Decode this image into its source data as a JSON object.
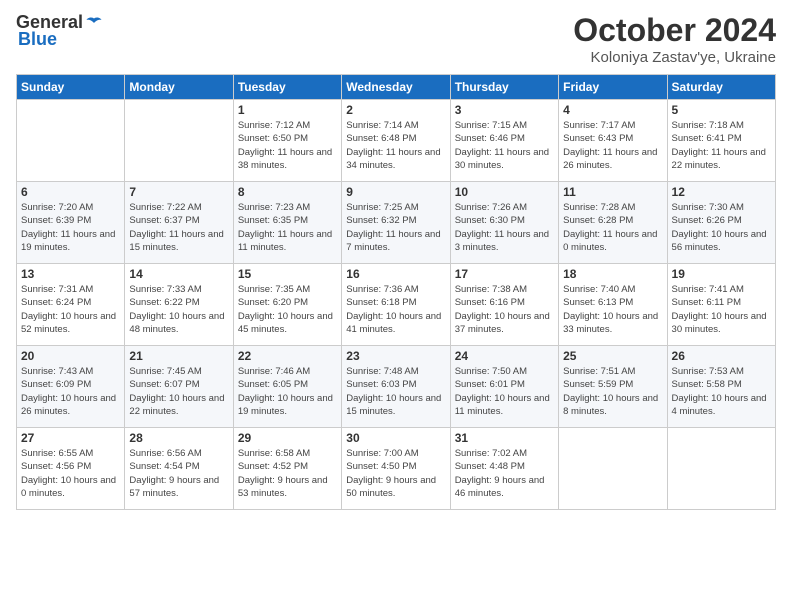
{
  "logo": {
    "general": "General",
    "blue": "Blue"
  },
  "title": "October 2024",
  "subtitle": "Koloniya Zastav'ye, Ukraine",
  "weekdays": [
    "Sunday",
    "Monday",
    "Tuesday",
    "Wednesday",
    "Thursday",
    "Friday",
    "Saturday"
  ],
  "weeks": [
    [
      {
        "day": "",
        "info": ""
      },
      {
        "day": "",
        "info": ""
      },
      {
        "day": "1",
        "info": "Sunrise: 7:12 AM\nSunset: 6:50 PM\nDaylight: 11 hours and 38 minutes."
      },
      {
        "day": "2",
        "info": "Sunrise: 7:14 AM\nSunset: 6:48 PM\nDaylight: 11 hours and 34 minutes."
      },
      {
        "day": "3",
        "info": "Sunrise: 7:15 AM\nSunset: 6:46 PM\nDaylight: 11 hours and 30 minutes."
      },
      {
        "day": "4",
        "info": "Sunrise: 7:17 AM\nSunset: 6:43 PM\nDaylight: 11 hours and 26 minutes."
      },
      {
        "day": "5",
        "info": "Sunrise: 7:18 AM\nSunset: 6:41 PM\nDaylight: 11 hours and 22 minutes."
      }
    ],
    [
      {
        "day": "6",
        "info": "Sunrise: 7:20 AM\nSunset: 6:39 PM\nDaylight: 11 hours and 19 minutes."
      },
      {
        "day": "7",
        "info": "Sunrise: 7:22 AM\nSunset: 6:37 PM\nDaylight: 11 hours and 15 minutes."
      },
      {
        "day": "8",
        "info": "Sunrise: 7:23 AM\nSunset: 6:35 PM\nDaylight: 11 hours and 11 minutes."
      },
      {
        "day": "9",
        "info": "Sunrise: 7:25 AM\nSunset: 6:32 PM\nDaylight: 11 hours and 7 minutes."
      },
      {
        "day": "10",
        "info": "Sunrise: 7:26 AM\nSunset: 6:30 PM\nDaylight: 11 hours and 3 minutes."
      },
      {
        "day": "11",
        "info": "Sunrise: 7:28 AM\nSunset: 6:28 PM\nDaylight: 11 hours and 0 minutes."
      },
      {
        "day": "12",
        "info": "Sunrise: 7:30 AM\nSunset: 6:26 PM\nDaylight: 10 hours and 56 minutes."
      }
    ],
    [
      {
        "day": "13",
        "info": "Sunrise: 7:31 AM\nSunset: 6:24 PM\nDaylight: 10 hours and 52 minutes."
      },
      {
        "day": "14",
        "info": "Sunrise: 7:33 AM\nSunset: 6:22 PM\nDaylight: 10 hours and 48 minutes."
      },
      {
        "day": "15",
        "info": "Sunrise: 7:35 AM\nSunset: 6:20 PM\nDaylight: 10 hours and 45 minutes."
      },
      {
        "day": "16",
        "info": "Sunrise: 7:36 AM\nSunset: 6:18 PM\nDaylight: 10 hours and 41 minutes."
      },
      {
        "day": "17",
        "info": "Sunrise: 7:38 AM\nSunset: 6:16 PM\nDaylight: 10 hours and 37 minutes."
      },
      {
        "day": "18",
        "info": "Sunrise: 7:40 AM\nSunset: 6:13 PM\nDaylight: 10 hours and 33 minutes."
      },
      {
        "day": "19",
        "info": "Sunrise: 7:41 AM\nSunset: 6:11 PM\nDaylight: 10 hours and 30 minutes."
      }
    ],
    [
      {
        "day": "20",
        "info": "Sunrise: 7:43 AM\nSunset: 6:09 PM\nDaylight: 10 hours and 26 minutes."
      },
      {
        "day": "21",
        "info": "Sunrise: 7:45 AM\nSunset: 6:07 PM\nDaylight: 10 hours and 22 minutes."
      },
      {
        "day": "22",
        "info": "Sunrise: 7:46 AM\nSunset: 6:05 PM\nDaylight: 10 hours and 19 minutes."
      },
      {
        "day": "23",
        "info": "Sunrise: 7:48 AM\nSunset: 6:03 PM\nDaylight: 10 hours and 15 minutes."
      },
      {
        "day": "24",
        "info": "Sunrise: 7:50 AM\nSunset: 6:01 PM\nDaylight: 10 hours and 11 minutes."
      },
      {
        "day": "25",
        "info": "Sunrise: 7:51 AM\nSunset: 5:59 PM\nDaylight: 10 hours and 8 minutes."
      },
      {
        "day": "26",
        "info": "Sunrise: 7:53 AM\nSunset: 5:58 PM\nDaylight: 10 hours and 4 minutes."
      }
    ],
    [
      {
        "day": "27",
        "info": "Sunrise: 6:55 AM\nSunset: 4:56 PM\nDaylight: 10 hours and 0 minutes."
      },
      {
        "day": "28",
        "info": "Sunrise: 6:56 AM\nSunset: 4:54 PM\nDaylight: 9 hours and 57 minutes."
      },
      {
        "day": "29",
        "info": "Sunrise: 6:58 AM\nSunset: 4:52 PM\nDaylight: 9 hours and 53 minutes."
      },
      {
        "day": "30",
        "info": "Sunrise: 7:00 AM\nSunset: 4:50 PM\nDaylight: 9 hours and 50 minutes."
      },
      {
        "day": "31",
        "info": "Sunrise: 7:02 AM\nSunset: 4:48 PM\nDaylight: 9 hours and 46 minutes."
      },
      {
        "day": "",
        "info": ""
      },
      {
        "day": "",
        "info": ""
      }
    ]
  ]
}
